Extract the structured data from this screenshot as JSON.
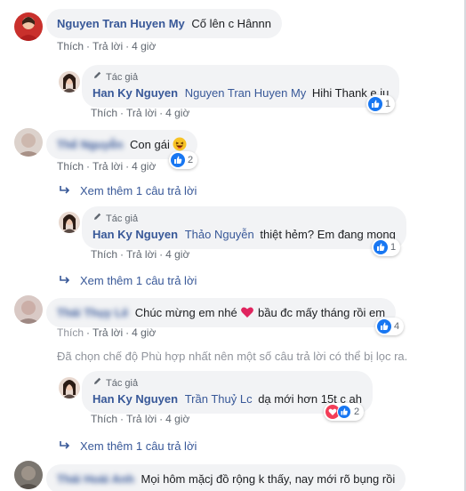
{
  "comments": [
    {
      "author": "Nguyen Tran Huyen My",
      "text": "Cố lên c Hânnn",
      "actions": {
        "like": "Thích",
        "reply": "Trả lời",
        "time": "4 giờ"
      }
    },
    {
      "badge": "Tác giả",
      "author": "Han Ky Nguyen",
      "mention": "Nguyen Tran Huyen My",
      "text": "Hihi Thank e iu",
      "actions": {
        "like": "Thích",
        "reply": "Trả lời",
        "time": "4 giờ"
      },
      "reactions": {
        "count": "1",
        "types": [
          "like"
        ]
      }
    },
    {
      "author": "Thế Nguyễn",
      "text": "Con gái",
      "emoji": "laughing-face",
      "actions": {
        "like": "Thích",
        "reply": "Trả lời",
        "time": "4 giờ"
      },
      "reactions": {
        "count": "2",
        "types": [
          "like"
        ]
      },
      "more_replies": "Xem thêm 1 câu trả lời"
    },
    {
      "badge": "Tác giả",
      "author": "Han Ky Nguyen",
      "mention": "Thảo Nguyễn",
      "text": "thiệt hẻm? Em đang mong",
      "actions": {
        "like": "Thích",
        "reply": "Trả lời",
        "time": "4 giờ"
      },
      "reactions": {
        "count": "1",
        "types": [
          "like"
        ]
      },
      "more_replies": "Xem thêm 1 câu trả lời"
    },
    {
      "author": "Thái Thụy Lê",
      "text_before": "Chúc mừng em nhé",
      "emoji": "red-heart",
      "text_after": "bầu đc mấy tháng rồi em",
      "actions": {
        "like": "Thích",
        "reply": "Trả lời",
        "time": "4 giờ"
      },
      "reactions": {
        "count": "4",
        "types": [
          "like"
        ]
      }
    },
    {
      "badge": "Tác giả",
      "author": "Han Ky Nguyen",
      "mention": "Trần Thuỷ Lc",
      "text": "dạ mới hơn 15t c ah",
      "actions": {
        "like": "Thích",
        "reply": "Trả lời",
        "time": "4 giờ"
      },
      "reactions": {
        "count": "2",
        "types": [
          "love",
          "like"
        ]
      },
      "more_replies": "Xem thêm 1 câu trả lời"
    },
    {
      "author": "Thái Hoài Anh",
      "text": "Mọi hôm mặcj đồ rộng k thấy, nay mới rõ bụng rồi"
    }
  ],
  "filter_note": "Đã chọn chế độ Phù hợp nhất nên một số câu trả lời có thể bị lọc ra.",
  "colors": {
    "link": "#385898",
    "bubble": "#f2f3f5",
    "meta": "#606770",
    "like": "#1877f2",
    "love": "#f33e58"
  }
}
